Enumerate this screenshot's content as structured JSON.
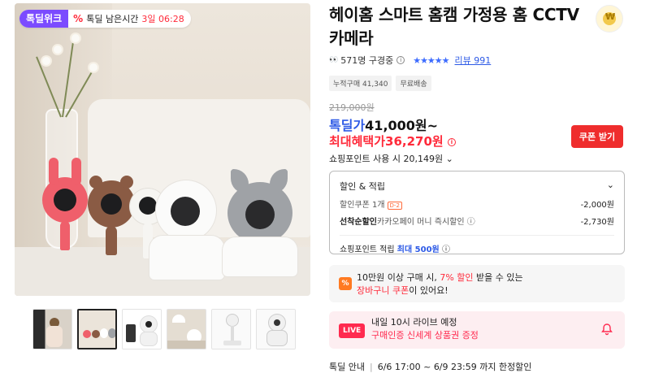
{
  "badge": {
    "brand": "톡딜위크",
    "pct_icon": "%",
    "label": "톡딜 남은시간",
    "time": "3일 06:28"
  },
  "product": {
    "title": "헤이홈 스마트 홈캠 가정용 홈 CCTV카메라"
  },
  "stats": {
    "viewers": "571명 구경중",
    "stars": "★★★★★",
    "review": "리뷰 991"
  },
  "tags": [
    "누적구매 41,340",
    "무료배송"
  ],
  "price": {
    "original": "219,000원",
    "deal_label": "톡딜가",
    "deal_value": "41,000원~",
    "max_label": "최대혜택가",
    "max_value": "36,270원",
    "coupon_button": "쿠폰 받기",
    "points_label": "쇼핑포인트 사용 시",
    "points_value": "20,149원"
  },
  "benefits": {
    "header": "할인 & 적립",
    "rows": [
      {
        "label": "할인쿠폰 1개",
        "badge": "D-2",
        "amount": "-2,000원"
      },
      {
        "label": "선착순할인",
        "sub": "카카오페이 머니 즉시할인",
        "amount": "-2,730원"
      }
    ],
    "points_label": "쇼핑포인트 적립",
    "points_value": "최대 500원"
  },
  "promo": {
    "line1a": "10만원 이상 구매 시,",
    "line1b": "7% 할인",
    "line1c": "받을 수 있는",
    "line2a": "장바구니 쿠폰",
    "line2b": "이 있어요!"
  },
  "live": {
    "tag": "LIVE",
    "line1": "내일 10시 라이브 예정",
    "line2": "구매인증 신세계 상품권 증정"
  },
  "notice": {
    "label": "톡딜 안내",
    "text": "6/6 17:00 ~ 6/9 23:59 까지 한정할인"
  },
  "colors": {
    "accent_red": "#ef2d2d",
    "accent_blue": "#2d5ae6",
    "brand_purple": "#7b4bff"
  }
}
